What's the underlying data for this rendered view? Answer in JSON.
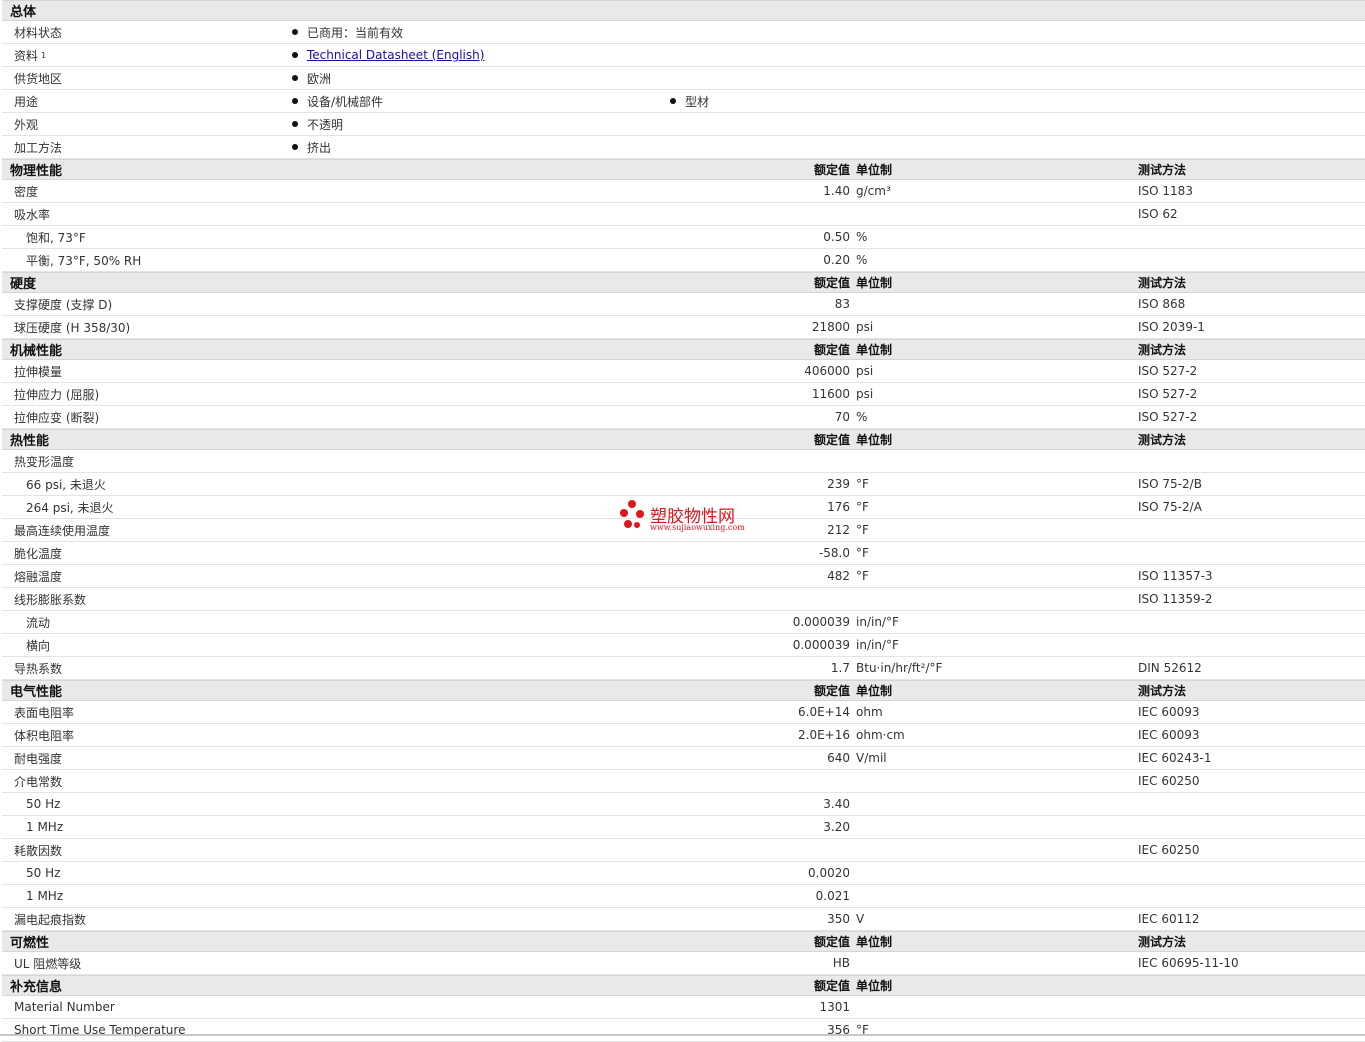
{
  "general": {
    "title": "总体",
    "rows": [
      {
        "label": "材料状态",
        "b1": "已商用：当前有效"
      },
      {
        "label": "资料",
        "sup": "1",
        "link": "Technical Datasheet (English)"
      },
      {
        "label": "供货地区",
        "b1": "欧洲"
      },
      {
        "label": "用途",
        "b1": "设备/机械部件",
        "b2": "型材"
      },
      {
        "label": "外观",
        "b1": "不透明"
      },
      {
        "label": "加工方法",
        "b1": "挤出"
      }
    ]
  },
  "headers": {
    "value": "额定值",
    "unit": "单位制",
    "test": "测试方法"
  },
  "sections": [
    {
      "title": "物理性能",
      "rows": [
        {
          "label": "密度",
          "value": "1.40",
          "unit": "g/cm³",
          "test": "ISO 1183"
        },
        {
          "label": "吸水率",
          "value": "",
          "unit": "",
          "test": "ISO 62"
        },
        {
          "label": "饱和, 73°F",
          "sub": true,
          "value": "0.50",
          "unit": "%",
          "test": ""
        },
        {
          "label": "平衡, 73°F, 50% RH",
          "sub": true,
          "value": "0.20",
          "unit": "%",
          "test": ""
        }
      ]
    },
    {
      "title": "硬度",
      "rows": [
        {
          "label": "支撑硬度 (支撑 D)",
          "value": "83",
          "unit": "",
          "test": "ISO 868"
        },
        {
          "label": "球压硬度 (H 358/30)",
          "value": "21800",
          "unit": "psi",
          "test": "ISO 2039-1"
        }
      ]
    },
    {
      "title": "机械性能",
      "rows": [
        {
          "label": "拉伸模量",
          "value": "406000",
          "unit": "psi",
          "test": "ISO 527-2"
        },
        {
          "label": "拉伸应力 (屈服)",
          "value": "11600",
          "unit": "psi",
          "test": "ISO 527-2"
        },
        {
          "label": "拉伸应变 (断裂)",
          "value": "70",
          "unit": "%",
          "test": "ISO 527-2"
        }
      ]
    },
    {
      "title": "热性能",
      "rows": [
        {
          "label": "热变形温度",
          "value": "",
          "unit": "",
          "test": ""
        },
        {
          "label": "66 psi, 未退火",
          "sub": true,
          "value": "239",
          "unit": "°F",
          "test": "ISO 75-2/B"
        },
        {
          "label": "264 psi, 未退火",
          "sub": true,
          "value": "176",
          "unit": "°F",
          "test": "ISO 75-2/A"
        },
        {
          "label": "最高连续使用温度",
          "value": "212",
          "unit": "°F",
          "test": ""
        },
        {
          "label": "脆化温度",
          "value": "-58.0",
          "unit": "°F",
          "test": ""
        },
        {
          "label": "熔融温度",
          "value": "482",
          "unit": "°F",
          "test": "ISO 11357-3"
        },
        {
          "label": "线形膨胀系数",
          "value": "",
          "unit": "",
          "test": "ISO 11359-2"
        },
        {
          "label": "流动",
          "sub": true,
          "value": "0.000039",
          "unit": "in/in/°F",
          "test": ""
        },
        {
          "label": "横向",
          "sub": true,
          "value": "0.000039",
          "unit": "in/in/°F",
          "test": ""
        },
        {
          "label": "导热系数",
          "value": "1.7",
          "unit": "Btu·in/hr/ft²/°F",
          "test": "DIN 52612"
        }
      ]
    },
    {
      "title": "电气性能",
      "rows": [
        {
          "label": "表面电阻率",
          "value": "6.0E+14",
          "unit": "ohm",
          "test": "IEC 60093"
        },
        {
          "label": "体积电阻率",
          "value": "2.0E+16",
          "unit": "ohm·cm",
          "test": "IEC 60093"
        },
        {
          "label": "耐电强度",
          "value": "640",
          "unit": "V/mil",
          "test": "IEC 60243-1"
        },
        {
          "label": "介电常数",
          "value": "",
          "unit": "",
          "test": "IEC 60250"
        },
        {
          "label": "50 Hz",
          "sub": true,
          "value": "3.40",
          "unit": "",
          "test": ""
        },
        {
          "label": "1 MHz",
          "sub": true,
          "value": "3.20",
          "unit": "",
          "test": ""
        },
        {
          "label": "耗散因数",
          "value": "",
          "unit": "",
          "test": "IEC 60250"
        },
        {
          "label": "50 Hz",
          "sub": true,
          "value": "0.0020",
          "unit": "",
          "test": ""
        },
        {
          "label": "1 MHz",
          "sub": true,
          "value": "0.021",
          "unit": "",
          "test": ""
        },
        {
          "label": "漏电起痕指数",
          "value": "350",
          "unit": "V",
          "test": "IEC 60112"
        }
      ]
    },
    {
      "title": "可燃性",
      "rows": [
        {
          "label": "UL 阻燃等级",
          "value": "HB",
          "unit": "",
          "test": "IEC 60695-11-10"
        }
      ]
    },
    {
      "title": "补充信息",
      "noTest": true,
      "rows": [
        {
          "label": "Material Number",
          "value": "1301",
          "unit": "",
          "test": ""
        },
        {
          "label": "Short Time Use Temperature",
          "value": "356",
          "unit": "°F",
          "test": ""
        }
      ]
    }
  ],
  "watermark": {
    "text": "塑胶物性网",
    "sub": "www.sujiaowuxing.com"
  },
  "colors": {
    "watermark": "#e0141e",
    "link": "#1a0dab",
    "section_bg": "#e9e9e9"
  }
}
